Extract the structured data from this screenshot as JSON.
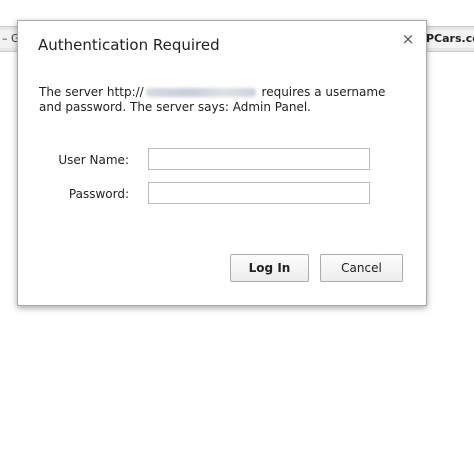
{
  "background": {
    "left_tab_label": "– G",
    "right_tab_label": "PCars.co"
  },
  "dialog": {
    "title": "Authentication Required",
    "close_glyph": "×",
    "message_prefix": "The server http://",
    "message_suffix": " requires a username and password. The server says: Admin Panel.",
    "username_label": "User Name:",
    "username_value": "",
    "password_label": "Password:",
    "password_value": "",
    "login_label": "Log In",
    "cancel_label": "Cancel"
  }
}
